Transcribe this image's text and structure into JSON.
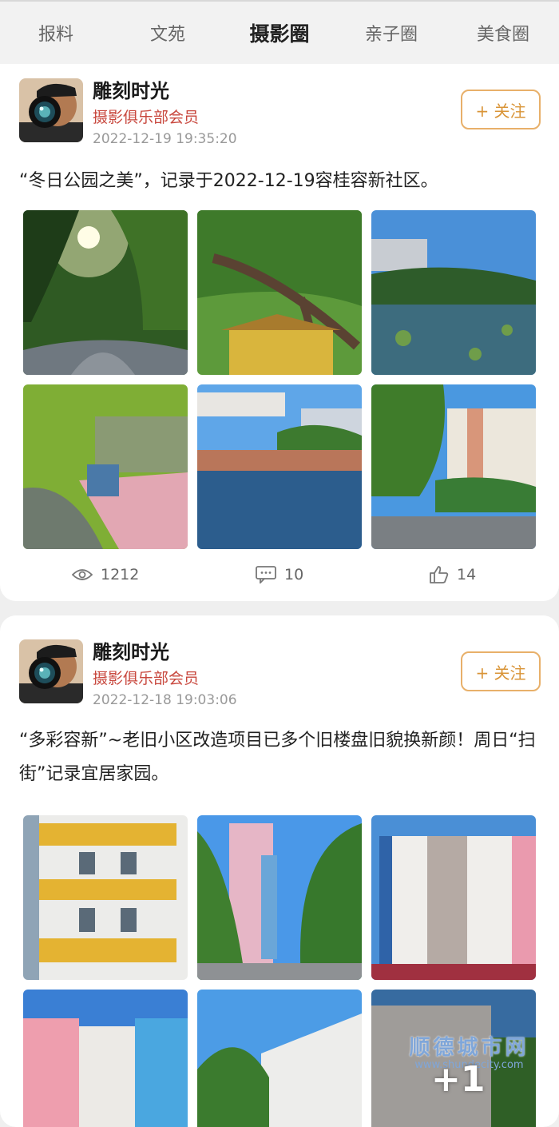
{
  "tabs": [
    {
      "label": "报料"
    },
    {
      "label": "文苑"
    },
    {
      "label": "摄影圈"
    },
    {
      "label": "亲子圈"
    },
    {
      "label": "美食圈"
    }
  ],
  "posts": [
    {
      "author": "雕刻时光",
      "role": "摄影俱乐部会员",
      "time": "2022-12-19 19:35:20",
      "follow_label": "+ 关注",
      "text": "“冬日公园之美”，记录于2022-12-19容桂容新社区。",
      "stats": {
        "views": "1212",
        "comments": "10",
        "likes": "14"
      }
    },
    {
      "author": "雕刻时光",
      "role": "摄影俱乐部会员",
      "time": "2022-12-18 19:03:06",
      "follow_label": "+ 关注",
      "text": "“多彩容新”~老旧小区改造项目已多个旧楼盘旧貌换新颜！周日“扫街”记录宜居家园。",
      "more_count": "+1"
    }
  ],
  "watermark": {
    "cn": "顺德城市网",
    "url": "www.shundecity.com"
  },
  "colors": {
    "accent": "#c8473d",
    "follow": "#d99437",
    "tab_bg": "#f2f2f2"
  }
}
